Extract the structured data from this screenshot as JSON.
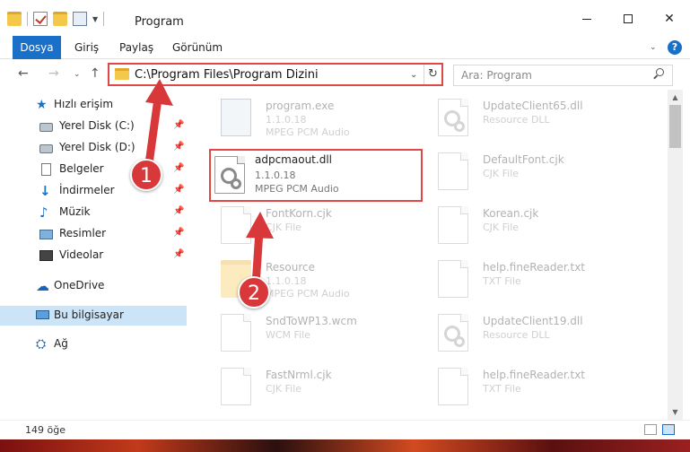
{
  "window": {
    "title": "Program",
    "minimize_glyph": "—",
    "close_glyph": "✕"
  },
  "ribbon": {
    "tabs": [
      "Dosya",
      "Giriş",
      "Paylaş",
      "Görünüm"
    ],
    "help_glyph": "?"
  },
  "address": {
    "path": "C:\\Program Files\\Program Dizini",
    "refresh_glyph": "↻"
  },
  "search": {
    "placeholder": "Ara: Program"
  },
  "nav": {
    "quick_access": "Hızlı erişim",
    "items": [
      {
        "label": "Yerel Disk (C:)",
        "icon": "drive-icon"
      },
      {
        "label": "Yerel Disk (D:)",
        "icon": "drive-icon"
      },
      {
        "label": "Belgeler",
        "icon": "documents-icon"
      },
      {
        "label": "İndirmeler",
        "icon": "download-icon"
      },
      {
        "label": "Müzik",
        "icon": "music-icon"
      },
      {
        "label": "Resimler",
        "icon": "pictures-icon"
      },
      {
        "label": "Videolar",
        "icon": "videos-icon"
      }
    ],
    "onedrive": "OneDrive",
    "this_pc": "Bu bilgisayar",
    "network": "Ağ"
  },
  "files": {
    "left": [
      {
        "name": "program.exe",
        "line2": "1.1.0.18",
        "line3": "MPEG PCM Audio",
        "icon": "exe-icon"
      },
      {
        "name": "adpcmaout.dll",
        "line2": "1.1.0.18",
        "line3": "MPEG PCM Audio",
        "icon": "dll-gear-icon"
      },
      {
        "name": "FontKorn.cjk",
        "line2": "CJK File",
        "line3": "",
        "icon": "file-icon"
      },
      {
        "name": "Resource",
        "line2": "1.1.0.18",
        "line3": "MPEG PCM Audio",
        "icon": "folder-icon"
      },
      {
        "name": "SndToWP13.wcm",
        "line2": "WCM File",
        "line3": "",
        "icon": "file-icon"
      },
      {
        "name": "FastNrml.cjk",
        "line2": "CJK File",
        "line3": "",
        "icon": "file-icon"
      }
    ],
    "right": [
      {
        "name": "UpdateClient65.dll",
        "line2": "Resource DLL",
        "icon": "dll-gear-icon"
      },
      {
        "name": "DefaultFont.cjk",
        "line2": "CJK File",
        "icon": "file-icon"
      },
      {
        "name": "Korean.cjk",
        "line2": "CJK File",
        "icon": "file-icon"
      },
      {
        "name": "help.fineReader.txt",
        "line2": "TXT File",
        "icon": "text-file-icon"
      },
      {
        "name": "UpdateClient19.dll",
        "line2": "Resource DLL",
        "icon": "dll-gear-icon"
      },
      {
        "name": "help.fineReader.txt",
        "line2": "TXT File",
        "icon": "text-file-icon"
      }
    ]
  },
  "callouts": [
    "1",
    "2"
  ],
  "status": {
    "count": "149 öğe"
  },
  "colors": {
    "accent": "#1a6fc9",
    "highlight_red": "#e04848",
    "callout_red": "#d9383a",
    "selection": "#cce4f7"
  }
}
